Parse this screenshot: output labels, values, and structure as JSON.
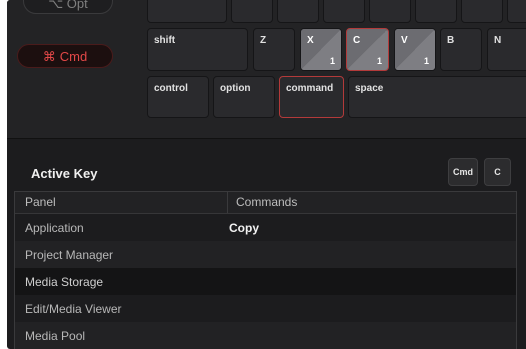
{
  "modifiers": {
    "opt_label": "⌥ Opt",
    "cmd_symbol": "⌘",
    "cmd_label": "Cmd"
  },
  "keyboard": {
    "shift": "shift",
    "z": "Z",
    "x": "X",
    "x_count": "1",
    "c": "C",
    "c_count": "1",
    "v": "V",
    "v_count": "1",
    "b": "B",
    "n": "N",
    "control": "control",
    "option": "option",
    "command": "command",
    "space": "space"
  },
  "active_key": {
    "title": "Active Key",
    "btn_cmd": "Cmd",
    "btn_c": "C"
  },
  "table": {
    "headers": [
      "Panel",
      "Commands"
    ],
    "rows": [
      {
        "panel": "Application",
        "command": "Copy"
      },
      {
        "panel": "Project Manager",
        "command": ""
      },
      {
        "panel": "Media Storage",
        "command": ""
      },
      {
        "panel": "Edit/Media Viewer",
        "command": ""
      },
      {
        "panel": "Media Pool",
        "command": ""
      }
    ]
  },
  "colors": {
    "accent_red": "#e34848",
    "selected_border": "#b33a3a",
    "background": "#1c1c1e"
  }
}
